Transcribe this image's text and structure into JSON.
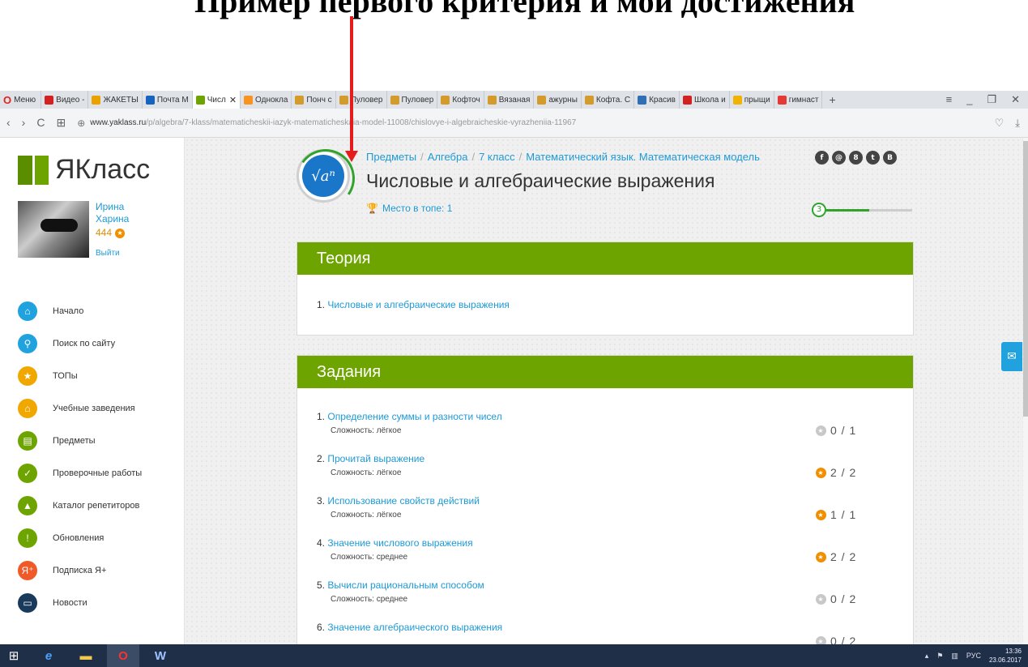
{
  "annotation": {
    "text": "Пример первого критерия и мои достижения"
  },
  "browser": {
    "menu_label": "Меню",
    "tabs": [
      {
        "label": "Видео -",
        "color": "#d32020"
      },
      {
        "label": "ЖАКЕТЫ",
        "color": "#e9a200"
      },
      {
        "label": "Почта М",
        "color": "#1565c0"
      },
      {
        "label": "Числ",
        "color": "#6ea400",
        "active": true
      },
      {
        "label": "Одноклa",
        "color": "#f7931e"
      },
      {
        "label": "Понч с",
        "color": "#d49b2a"
      },
      {
        "label": "Пуловер",
        "color": "#d49b2a"
      },
      {
        "label": "Пуловер",
        "color": "#d49b2a"
      },
      {
        "label": "Кофточ",
        "color": "#d49b2a"
      },
      {
        "label": "Вязаная",
        "color": "#d49b2a"
      },
      {
        "label": "ажурны",
        "color": "#d49b2a"
      },
      {
        "label": "Кофта. С",
        "color": "#d49b2a"
      },
      {
        "label": "Красив",
        "color": "#2e6fb5"
      },
      {
        "label": "Школа и",
        "color": "#d32020"
      },
      {
        "label": "прыщи",
        "color": "#f0b400"
      },
      {
        "label": "гимнаст",
        "color": "#e53935"
      }
    ],
    "tab_close": "✕",
    "newtab": "+",
    "url_host": "www.yaklass.ru",
    "url_path": "/p/algebra/7-klass/matematicheskii-iazyk-matematicheskaia-model-11008/chislovye-i-algebraicheskie-vyrazheniia-11967"
  },
  "site": {
    "logo": "ЯКласс",
    "user": {
      "first": "Ирина",
      "last": "Харина",
      "points": "444",
      "logout": "Выйти"
    },
    "nav": [
      {
        "label": "Начало",
        "icon": "⌂",
        "color": "#1fa2de"
      },
      {
        "label": "Поиск по сайту",
        "icon": "⚲",
        "color": "#1fa2de"
      },
      {
        "label": "ТОПы",
        "icon": "★",
        "color": "#f0a800"
      },
      {
        "label": "Учебные заведения",
        "icon": "⌂",
        "color": "#f0a800"
      },
      {
        "label": "Предметы",
        "icon": "▤",
        "color": "#6ea400"
      },
      {
        "label": "Проверочные работы",
        "icon": "✓",
        "color": "#6ea400"
      },
      {
        "label": "Каталог репетиторов",
        "icon": "▲",
        "color": "#6ea400"
      },
      {
        "label": "Обновления",
        "icon": "!",
        "color": "#6ea400"
      },
      {
        "label": "Подписка Я+",
        "icon": "Я⁺",
        "color": "#f05a28"
      },
      {
        "label": "Новости",
        "icon": "▭",
        "color": "#1a3a5c"
      }
    ]
  },
  "breadcrumbs": [
    "Предметы",
    "Алгебра",
    "7 класс",
    "Математический язык. Математическая модель"
  ],
  "page_title": "Числовые и алгебраические выражения",
  "top_place": "Место в топе: 1",
  "topic_icon": "√aⁿ",
  "progress": {
    "level": "3",
    "fraction": 0.5
  },
  "socials": [
    "f",
    "@",
    "8",
    "t",
    "B"
  ],
  "theory": {
    "heading": "Теория",
    "items": [
      {
        "num": "1.",
        "label": "Числовые и алгебраические выражения"
      }
    ]
  },
  "tasks": {
    "heading": "Задания",
    "items": [
      {
        "num": "1.",
        "label": "Определение суммы и разности чисел",
        "difficulty": "Сложность: лёгкое",
        "score": "0 / 1",
        "earned": false
      },
      {
        "num": "2.",
        "label": "Прочитай выражение",
        "difficulty": "Сложность: лёгкое",
        "score": "2 / 2",
        "earned": true
      },
      {
        "num": "3.",
        "label": "Использование свойств действий",
        "difficulty": "Сложность: лёгкое",
        "score": "1 / 1",
        "earned": true
      },
      {
        "num": "4.",
        "label": "Значение числового выражения",
        "difficulty": "Сложность: среднее",
        "score": "2 / 2",
        "earned": true
      },
      {
        "num": "5.",
        "label": "Вычисли рациональным способом",
        "difficulty": "Сложность: среднее",
        "score": "0 / 2",
        "earned": false
      },
      {
        "num": "6.",
        "label": "Значение алгебраического выражения",
        "difficulty": "",
        "score": "0 / 2",
        "earned": false
      }
    ]
  },
  "taskbar": {
    "lang": "РУС",
    "time": "13:36",
    "date": "23.06.2017"
  }
}
